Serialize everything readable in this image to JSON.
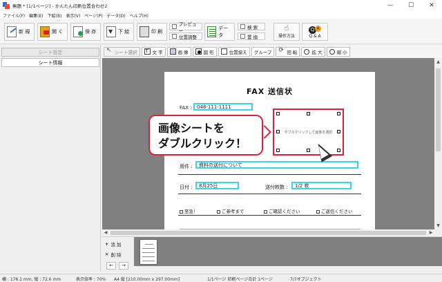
{
  "window": {
    "title": "無題 * [1/1ページ] - かんたん印刷位置合わせ2",
    "minimize": "—",
    "maximize": "☐",
    "close": "✕"
  },
  "menu": [
    "ファイル(F)",
    "編集(E)",
    "下絵(B)",
    "表示(V)",
    "ページ(P)",
    "データ(D)",
    "ヘルプ(H)"
  ],
  "toolbar": {
    "new": "新 規",
    "open": "開 く",
    "save": "保 存",
    "underlay": "下 絵",
    "print": "印 刷",
    "preview": "プレビュー",
    "position_adjust": "位置調整",
    "data": "データ",
    "search": "検 索",
    "replace": "置 換",
    "how_to": "操作方法",
    "qa": "Q & A"
  },
  "left_panel": {
    "sheet_settings": "シート設定",
    "sheet_info": "シート情報"
  },
  "draw_toolbar": {
    "select_sheet": "シート選択",
    "text": "文 字",
    "image": "画 像",
    "shape": "図 形",
    "align": "位置揃え",
    "group": "グループ",
    "rotate": "回 転",
    "zoom_in": "拡 大",
    "zoom_out": "縮 小"
  },
  "page": {
    "title": "FAX 送信状",
    "fax_label": "FAX :",
    "fax_value": "048-111-1111",
    "subject_label": "用件 :",
    "subject_value": "資料の送付について",
    "date_label": "日付 :",
    "date_value": "8月25日",
    "pages_label": "送付枚数 :",
    "pages_value": "1/2 枚",
    "checks": [
      "至急！",
      "ご参考まで",
      "ご確認ください",
      "ご返信ください"
    ],
    "image_placeholder": "ダブルクリックして画像を選択"
  },
  "callout": {
    "line1": "画像シートを",
    "line2": "ダブルクリック！"
  },
  "thumbnails": {
    "add": "追 加",
    "delete": "削 除",
    "add_symbol": "+",
    "delete_symbol": "✕",
    "prev": "←",
    "next": "→"
  },
  "status": {
    "dimensions": "横 : 176.1 mm, 縦 : 72.6 mm",
    "zoom": "表示倍率 : 70%",
    "paper": "A4 縦 [210.00mm x 297.00mm]",
    "page_count": "1/1ページ 印刷ページ合計 1ページ",
    "objects": "7/7オブジェクト"
  },
  "colors": {
    "field_border": "#35d5ef",
    "selection_border": "#e0203a",
    "canvas_bg": "#808080"
  }
}
